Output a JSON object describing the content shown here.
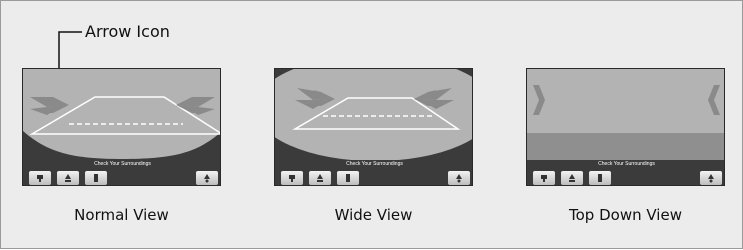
{
  "callout": {
    "label": "Arrow Icon"
  },
  "views": [
    {
      "caption": "Normal View",
      "status": "Check Your Surroundings"
    },
    {
      "caption": "Wide View",
      "status": "Check Your Surroundings"
    },
    {
      "caption": "Top Down View",
      "status": "Check Your Surroundings"
    }
  ],
  "toolbar_icons": [
    "normal-view-icon",
    "wide-view-icon",
    "top-down-view-icon",
    "camera-settings-icon"
  ],
  "colors": {
    "screen_bg": "#3b3b3b",
    "camera_bg": "#b3b3b3",
    "guide_line": "#ffffff"
  }
}
